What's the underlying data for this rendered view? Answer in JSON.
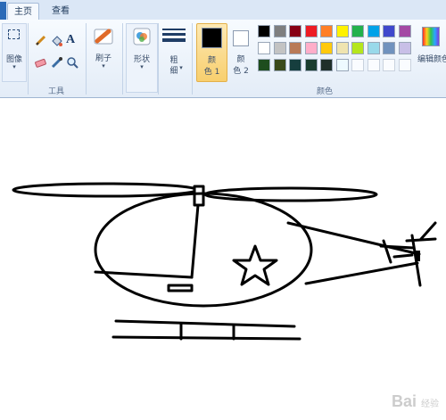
{
  "tabs": {
    "home": "主页",
    "view": "查看"
  },
  "ribbon": {
    "image_label": "图像",
    "tools_label": "工具",
    "brushes_label": "刷子",
    "shapes_label": "形状",
    "size_label_1": "粗",
    "size_label_2": "细",
    "color1_label_1": "颜",
    "color1_label_2": "色 1",
    "color2_label_1": "颜",
    "color2_label_2": "色 2",
    "colors_group_label": "颜色",
    "edit_colors_label": "编辑颜色"
  },
  "palette": {
    "row1": [
      "#000000",
      "#7f7f7f",
      "#880015",
      "#ed1c24",
      "#ff7f27",
      "#fff200",
      "#22b14c",
      "#00a2e8",
      "#3f48cc",
      "#a349a4"
    ],
    "row2": [
      "#ffffff",
      "#c3c3c3",
      "#b97a57",
      "#ffaec9",
      "#ffc90e",
      "#efe4b0",
      "#b5e61d",
      "#99d9ea",
      "#7092be",
      "#c8bfe7"
    ],
    "row3": [
      "#1e4d1e",
      "#3b4a1a",
      "#163e3e",
      "#1a3d2e",
      "#1f2f2a",
      "#eefaff",
      "",
      "",
      "",
      ""
    ]
  },
  "color1": "#000000",
  "color2": "#ffffff",
  "watermark": {
    "main": "Bai",
    "suffix": "经验"
  }
}
